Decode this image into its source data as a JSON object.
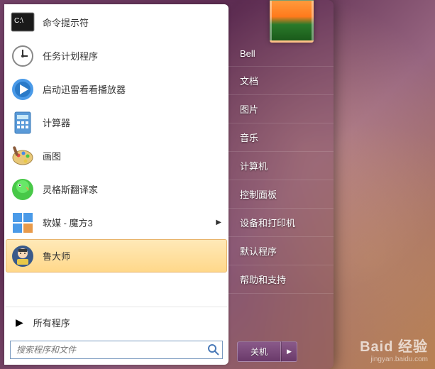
{
  "programs": [
    {
      "label": "命令提示符",
      "icon": "cmd"
    },
    {
      "label": "任务计划程序",
      "icon": "clock"
    },
    {
      "label": "启动迅雷看看播放器",
      "icon": "play"
    },
    {
      "label": "计算器",
      "icon": "calc"
    },
    {
      "label": "画图",
      "icon": "paint"
    },
    {
      "label": "灵格斯翻译家",
      "icon": "parrot"
    },
    {
      "label": "软媒 - 魔方3",
      "icon": "cube",
      "has_submenu": true
    },
    {
      "label": "鲁大师",
      "icon": "ludashi",
      "highlighted": true
    }
  ],
  "all_programs_label": "所有程序",
  "search": {
    "placeholder": "搜索程序和文件"
  },
  "right_items": [
    "Bell",
    "文档",
    "图片",
    "音乐",
    "计算机",
    "控制面板",
    "设备和打印机",
    "默认程序",
    "帮助和支持"
  ],
  "shutdown": {
    "label": "关机"
  },
  "watermark": {
    "brand": "Baid 经验",
    "url": "jingyan.baidu.com"
  }
}
